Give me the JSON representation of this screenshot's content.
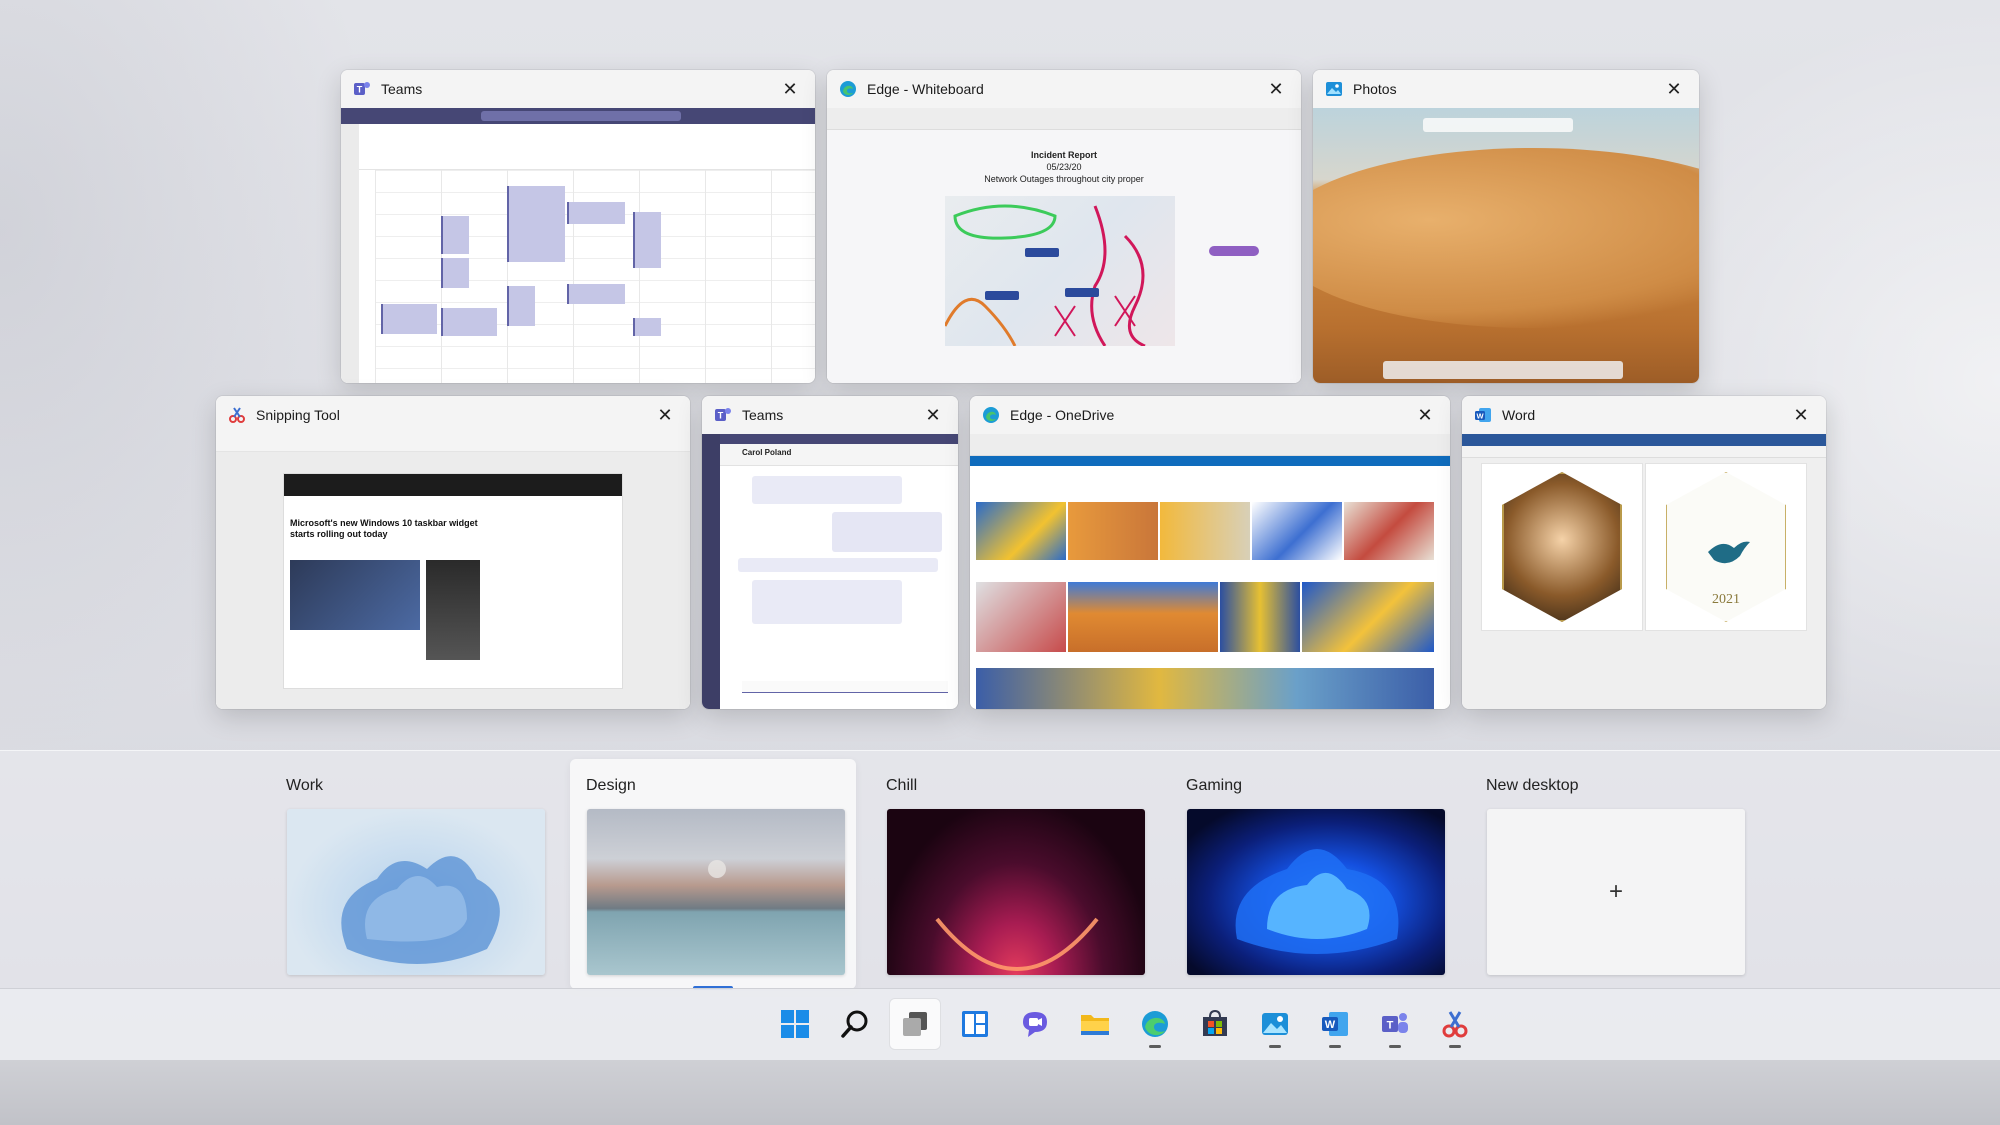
{
  "windows": {
    "teams_calendar": {
      "title": "Teams",
      "icon": "teams-icon"
    },
    "edge_whiteboard": {
      "title": "Edge - Whiteboard",
      "icon": "edge-icon",
      "board_title": "Incident Report",
      "board_date": "05/23/20",
      "board_subtitle": "Network Outages throughout city proper"
    },
    "photos": {
      "title": "Photos",
      "icon": "photos-icon"
    },
    "snipping_tool": {
      "title": "Snipping Tool",
      "icon": "snipping-tool-icon",
      "headline": "Microsoft's new Windows 10 taskbar widget starts rolling out today"
    },
    "teams_chat": {
      "title": "Teams",
      "icon": "teams-icon",
      "contact": "Carol Poland"
    },
    "edge_onedrive": {
      "title": "Edge - OneDrive",
      "icon": "edge-icon"
    },
    "word": {
      "title": "Word",
      "icon": "word-icon",
      "card_year": "2021"
    }
  },
  "close_glyph": "✕",
  "desktops": [
    {
      "label": "Work",
      "wallpaper": "blue-bloom",
      "active": false
    },
    {
      "label": "Design",
      "wallpaper": "mountain-lake",
      "active": true
    },
    {
      "label": "Chill",
      "wallpaper": "red-glow",
      "active": false
    },
    {
      "label": "Gaming",
      "wallpaper": "blue-flower",
      "active": false
    },
    {
      "label": "New desktop",
      "add_glyph": "+",
      "active": false
    }
  ],
  "taskbar": [
    {
      "name": "start",
      "icon": "windows-logo-icon",
      "running": false
    },
    {
      "name": "search",
      "icon": "search-icon",
      "running": false
    },
    {
      "name": "task-view",
      "icon": "task-view-icon",
      "running": false,
      "pressed": true
    },
    {
      "name": "widgets",
      "icon": "widgets-icon",
      "running": false
    },
    {
      "name": "chat",
      "icon": "chat-icon",
      "running": false
    },
    {
      "name": "file-explorer",
      "icon": "folder-icon",
      "running": false
    },
    {
      "name": "edge",
      "icon": "edge-icon",
      "running": true
    },
    {
      "name": "store",
      "icon": "store-icon",
      "running": false
    },
    {
      "name": "photos",
      "icon": "photos-icon",
      "running": true
    },
    {
      "name": "word",
      "icon": "word-icon",
      "running": true
    },
    {
      "name": "teams",
      "icon": "teams-icon",
      "running": true
    },
    {
      "name": "snipping-tool",
      "icon": "snipping-tool-icon",
      "running": true
    }
  ],
  "colors": {
    "accent": "#2f6fd6",
    "teams": "#5b5fc7",
    "edge": "#1c9cd6",
    "word": "#2b579a"
  }
}
